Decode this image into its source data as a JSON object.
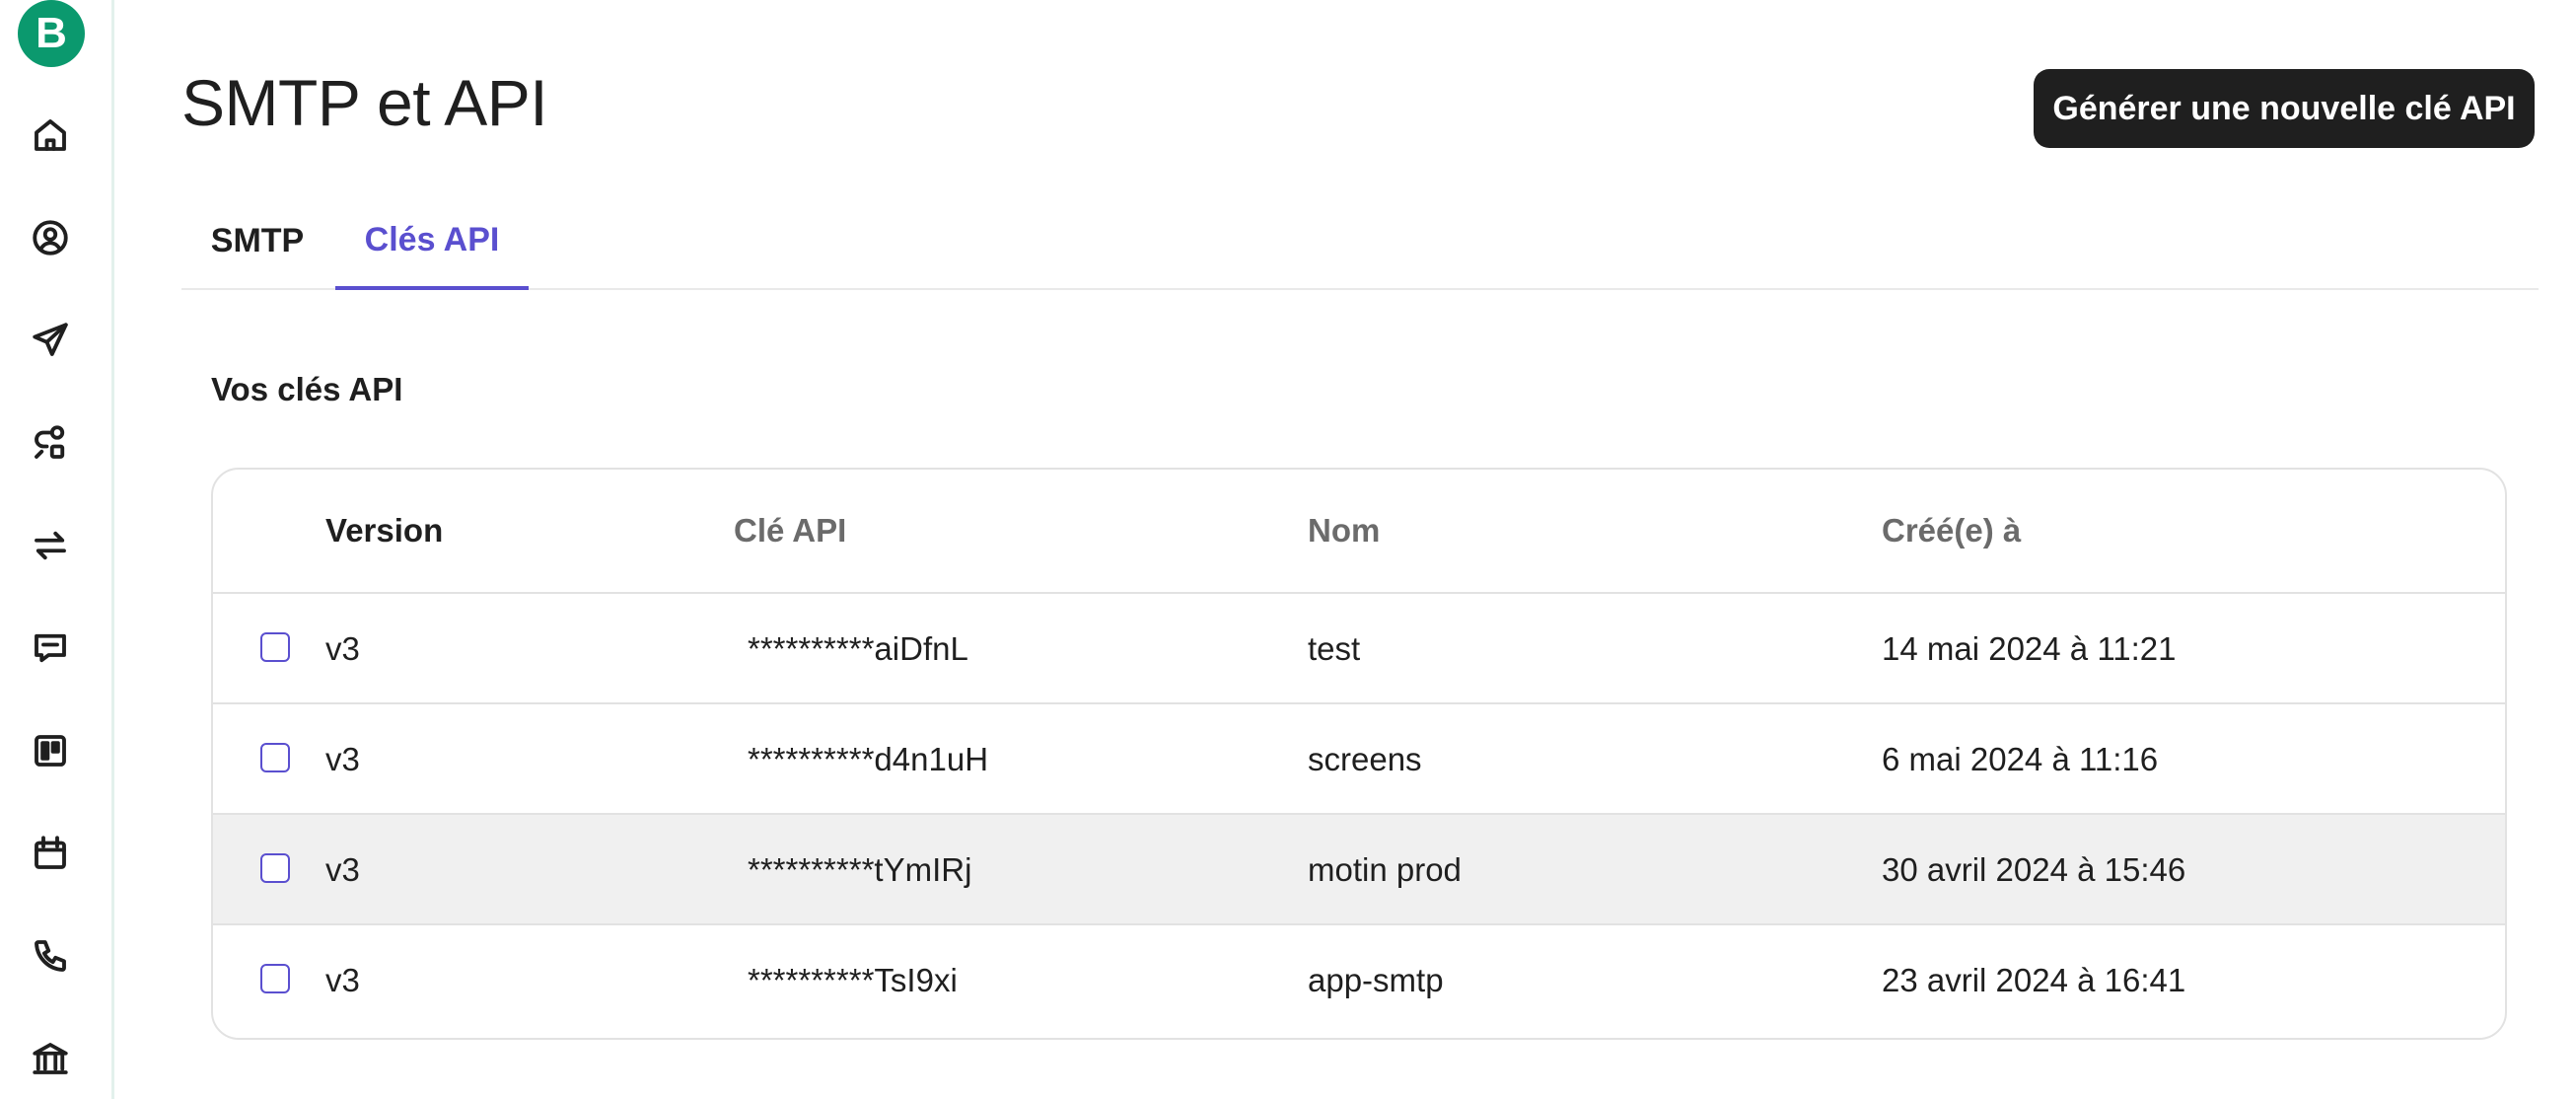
{
  "app": {
    "logo_letter": "B",
    "brand_color": "#0b996e",
    "accent_color": "#5a4fcf"
  },
  "sidebar": {
    "icons": [
      "home-icon",
      "contacts-icon",
      "send-icon",
      "automation-icon",
      "transactional-icon",
      "conversations-icon",
      "deals-icon",
      "meetings-icon",
      "phone-icon",
      "bank-icon"
    ]
  },
  "header": {
    "title": "SMTP et API",
    "generate_button": "Générer une nouvelle clé API"
  },
  "tabs": [
    {
      "label": "SMTP",
      "active": false
    },
    {
      "label": "Clés API",
      "active": true
    }
  ],
  "section": {
    "title": "Vos clés API"
  },
  "table": {
    "columns": [
      "Version",
      "Clé API",
      "Nom",
      "Créé(e) à"
    ],
    "rows": [
      {
        "version": "v3",
        "key": "**********aiDfnL",
        "name": "test",
        "created": "14 mai 2024 à 11:21"
      },
      {
        "version": "v3",
        "key": "**********d4n1uH",
        "name": "screens",
        "created": "6 mai 2024 à 11:16"
      },
      {
        "version": "v3",
        "key": "**********tYmIRj",
        "name": "motin prod",
        "created": "30 avril 2024 à 15:46"
      },
      {
        "version": "v3",
        "key": "**********TsI9xi",
        "name": "app-smtp",
        "created": "23 avril 2024 à 16:41"
      }
    ]
  }
}
